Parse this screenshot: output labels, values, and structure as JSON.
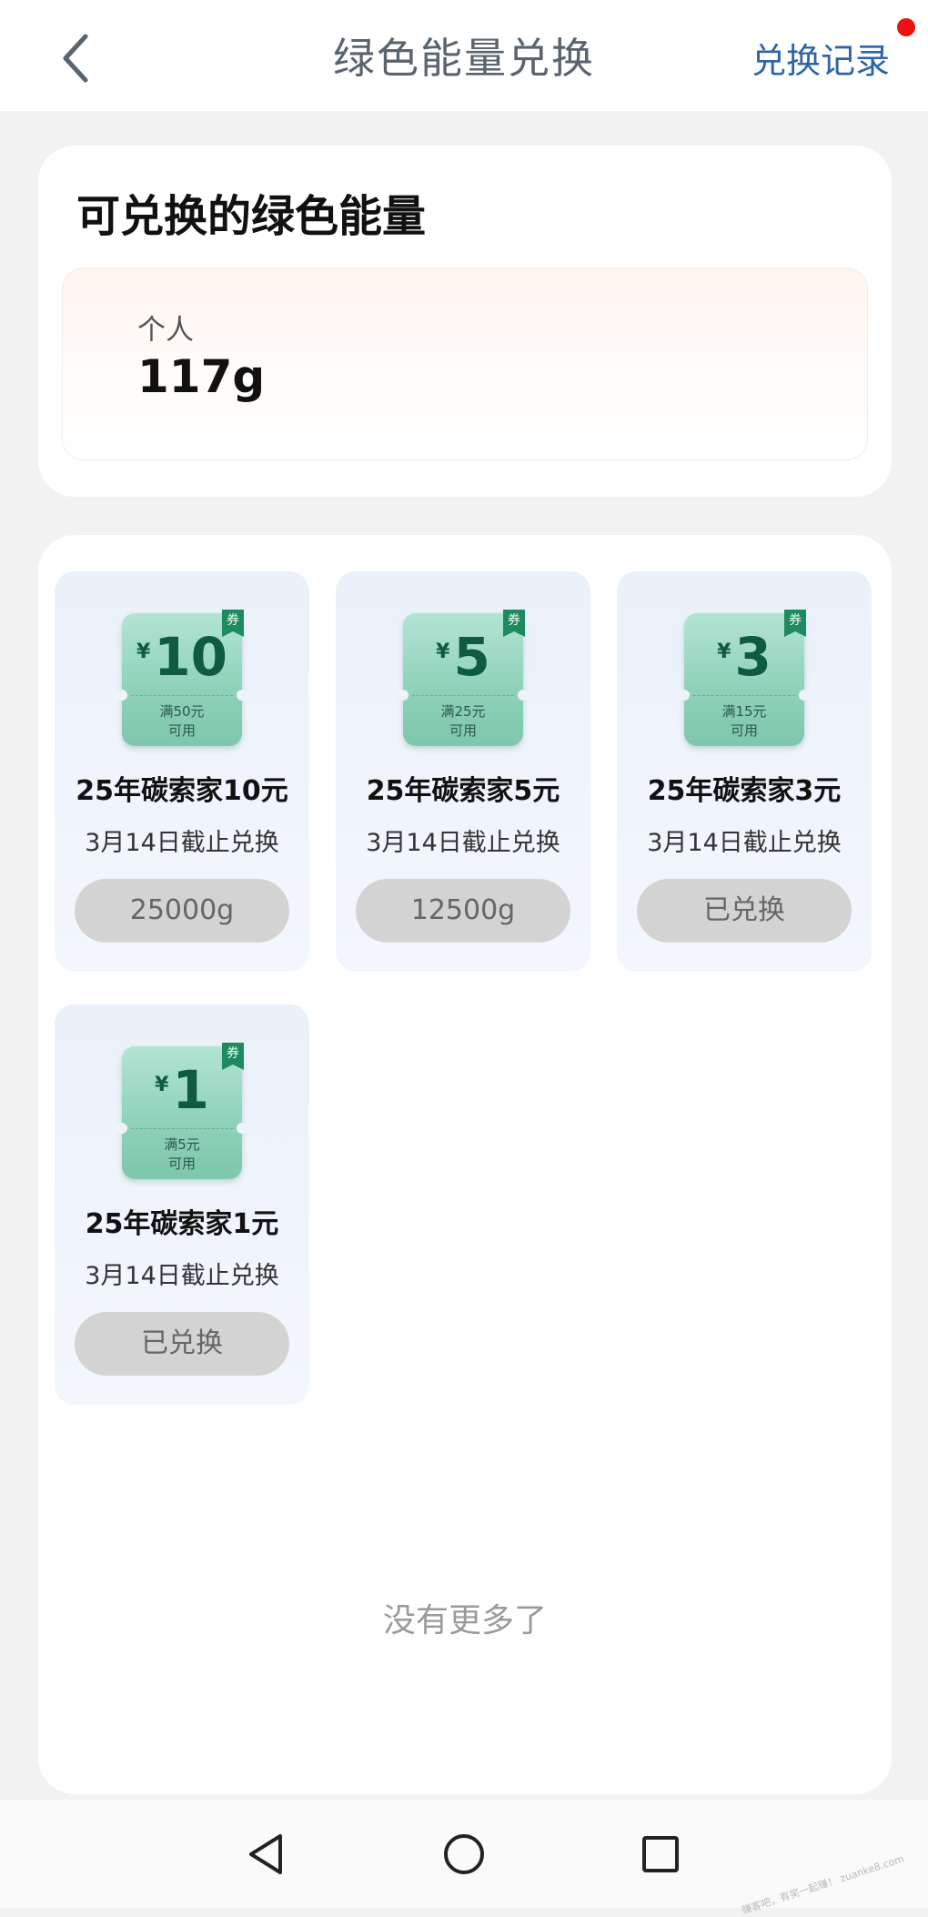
{
  "header": {
    "title": "绿色能量兑换",
    "record_label": "兑换记录"
  },
  "energy": {
    "title": "可兑换的绿色能量",
    "label": "个人",
    "value": "117g"
  },
  "coupons": [
    {
      "yen": "¥",
      "amount": "10",
      "cond1": "满50元",
      "cond2": "可用",
      "ribbon": "券",
      "title": "25年碳索家10元",
      "deadline": "3月14日截止兑换",
      "button": "25000g"
    },
    {
      "yen": "¥",
      "amount": "5",
      "cond1": "满25元",
      "cond2": "可用",
      "ribbon": "券",
      "title": "25年碳索家5元",
      "deadline": "3月14日截止兑换",
      "button": "12500g"
    },
    {
      "yen": "¥",
      "amount": "3",
      "cond1": "满15元",
      "cond2": "可用",
      "ribbon": "券",
      "title": "25年碳索家3元",
      "deadline": "3月14日截止兑换",
      "button": "已兑换"
    },
    {
      "yen": "¥",
      "amount": "1",
      "cond1": "满5元",
      "cond2": "可用",
      "ribbon": "券",
      "title": "25年碳索家1元",
      "deadline": "3月14日截止兑换",
      "button": "已兑换"
    }
  ],
  "footer_text": "没有更多了",
  "watermark": "赚客吧，有奖一起赚！ zuanke8.com",
  "colors": {
    "accent_link": "#2f64a6",
    "notification_dot": "#ee1111",
    "ticket_green": "#8fd2ba",
    "button_disabled": "#d3d3d3"
  },
  "icons": {
    "back": "chevron-left-icon",
    "nav_back": "triangle-back-icon",
    "nav_home": "circle-home-icon",
    "nav_recents": "square-recents-icon"
  }
}
